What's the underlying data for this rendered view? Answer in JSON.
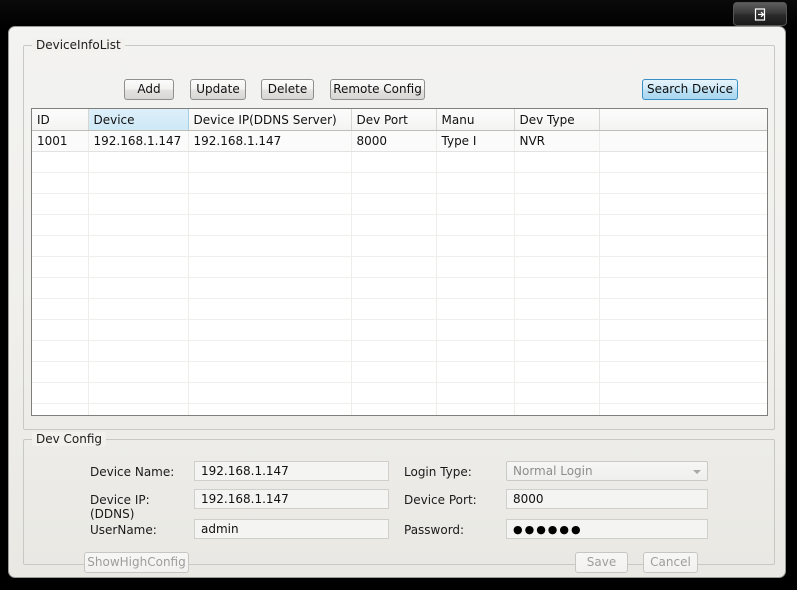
{
  "titlebar": {
    "button_icon": "logout-icon"
  },
  "device_list": {
    "group_title": "DeviceInfoList",
    "buttons": [
      {
        "name": "add",
        "label": "Add"
      },
      {
        "name": "update",
        "label": "Update"
      },
      {
        "name": "delete",
        "label": "Delete"
      },
      {
        "name": "remote-config",
        "label": "Remote Config"
      }
    ],
    "search_button": {
      "label": "Search Device",
      "accent_color": "#3a8fc4"
    },
    "columns": [
      "ID",
      "Device",
      "Device IP(DDNS Server)",
      "Dev Port",
      "Manu",
      "Dev Type",
      ""
    ],
    "selected_column_index": 1,
    "rows": [
      {
        "id": "1001",
        "device": "192.168.1.147",
        "device_ip": "192.168.1.147",
        "dev_port": "8000",
        "manu": "Type I",
        "dev_type": "NVR",
        "extra": ""
      }
    ],
    "empty_row_count": 13
  },
  "dev_config": {
    "group_title": "Dev Config",
    "labels": {
      "device_name": "Device Name:",
      "device_ip_line1": "Device IP:",
      "device_ip_line2": "(DDNS)",
      "username": "UserName:",
      "login_type": "Login Type:",
      "device_port": "Device Port:",
      "password": "Password:"
    },
    "values": {
      "device_name": "192.168.1.147",
      "device_ip": "192.168.1.147",
      "username": "admin",
      "login_type": "Normal Login",
      "device_port": "8000",
      "password_mask": "●●●●●●"
    },
    "placeholders": {
      "device_name": "",
      "device_ip": "",
      "username": "",
      "device_port": "",
      "password": ""
    },
    "buttons": {
      "show_high_config": "ShowHighConfig",
      "save": "Save",
      "cancel": "Cancel"
    }
  }
}
